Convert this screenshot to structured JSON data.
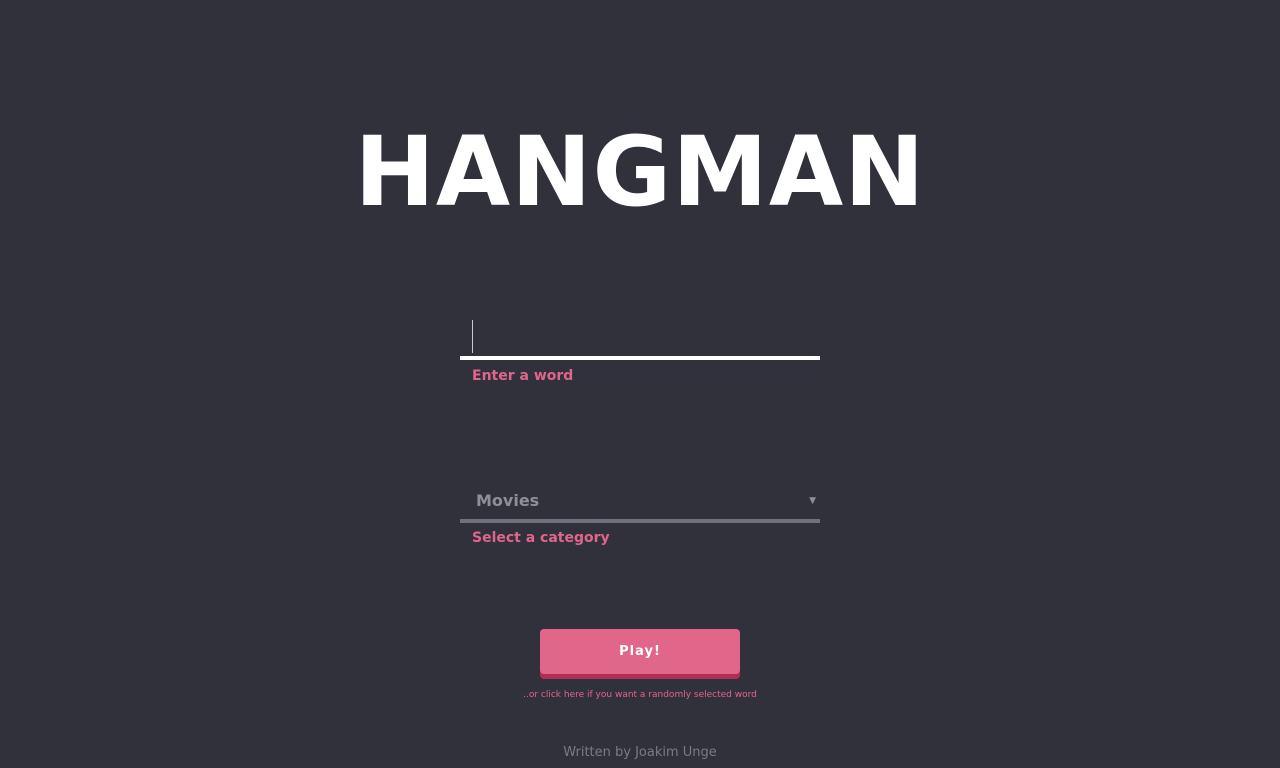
{
  "app": {
    "title": "HANGMAN"
  },
  "word_input": {
    "value": "",
    "label": "Enter a word"
  },
  "category_select": {
    "selected": "Movies",
    "label": "Select a category",
    "arrow_icon": "caret-down-icon"
  },
  "play_button": {
    "label": "Play!"
  },
  "random_word_link": {
    "text": "..or click here if you want a randomly selected word"
  },
  "footer": {
    "text": "Written by Joakim Unge"
  },
  "colors": {
    "background": "#30313a",
    "accent": "#e0668a",
    "accent_shadow": "#b02d57",
    "title": "#ffffff"
  }
}
